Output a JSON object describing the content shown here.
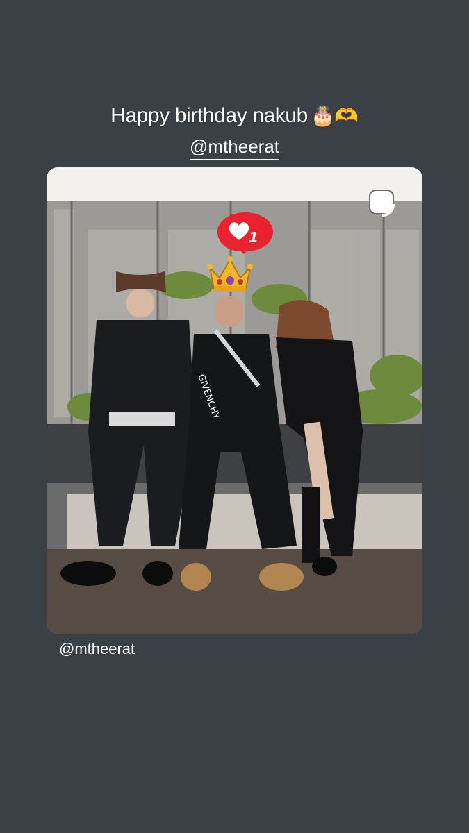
{
  "story": {
    "caption_text": "Happy birthday nakub",
    "caption_emojis": "🎂🫶",
    "mention_sticker": "@mtheerat",
    "reshared_post": {
      "like_count": "1",
      "stickers": [
        "heart-like-bubble",
        "crown-icon"
      ],
      "shirt_print": "GIVENCHY"
    },
    "mention_text": "@mtheerat"
  },
  "colors": {
    "background": "#3b4046",
    "like_bubble": "#e8232f",
    "crown": "#f1b62a"
  }
}
